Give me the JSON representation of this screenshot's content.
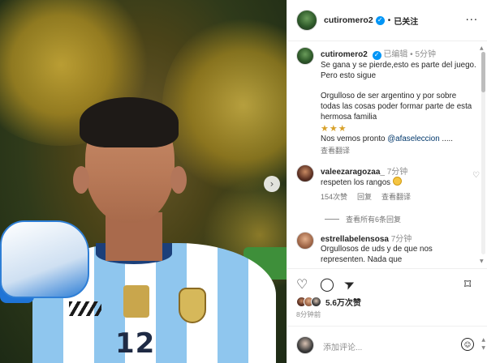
{
  "header": {
    "username": "cutiromero2",
    "verified_glyph": "✓",
    "separator": "•",
    "follow_status": "已关注",
    "more_glyph": "···"
  },
  "caption": {
    "username": "cutiromero2",
    "edited": "已编辑",
    "separator": "•",
    "time": "5分钟",
    "paragraph1": "Se gana y se pierde,esto es parte del juego. Pero esto sigue",
    "paragraph2": "Orgulloso de ser argentino y por sobre todas las cosas poder formar parte de esta hermosa familia",
    "stars": "★★★",
    "closing_prefix": "Nos vemos pronto",
    "mention": "@afaseleccion",
    "closing_suffix": " .....",
    "translate": "查看翻译"
  },
  "comments": [
    {
      "username": "valeezaragozaa_",
      "time": "7分钟",
      "text": "respeten los rangos",
      "likes": "154次赞",
      "reply": "回复",
      "translate": "查看翻译"
    },
    {
      "username": "estrellabelensosa",
      "time": "7分钟",
      "text": "Orgullosos de uds y de que nos representen. Nada que"
    }
  ],
  "view_replies": "查看所有6条回复",
  "actions": {
    "like_glyph": "♡",
    "comment_glyph": "◯",
    "share_glyph": "➤",
    "save_glyph": "⌑"
  },
  "likes": "5.6万次赞",
  "post_time": "8分钟前",
  "add_comment": {
    "placeholder": "添加评论...",
    "emoji_glyph": "☺"
  },
  "carousel": {
    "next_glyph": "›"
  },
  "photo": {
    "jersey_number": "12"
  },
  "icons": {
    "heart": "heart-icon",
    "comment": "comment-icon",
    "share": "share-icon",
    "save": "bookmark-icon",
    "emoji": "emoji-icon",
    "more": "more-icon"
  },
  "colors": {
    "accent": "#0095f6",
    "mention": "#00376b",
    "muted": "#8e8e8e",
    "text": "#262626"
  }
}
